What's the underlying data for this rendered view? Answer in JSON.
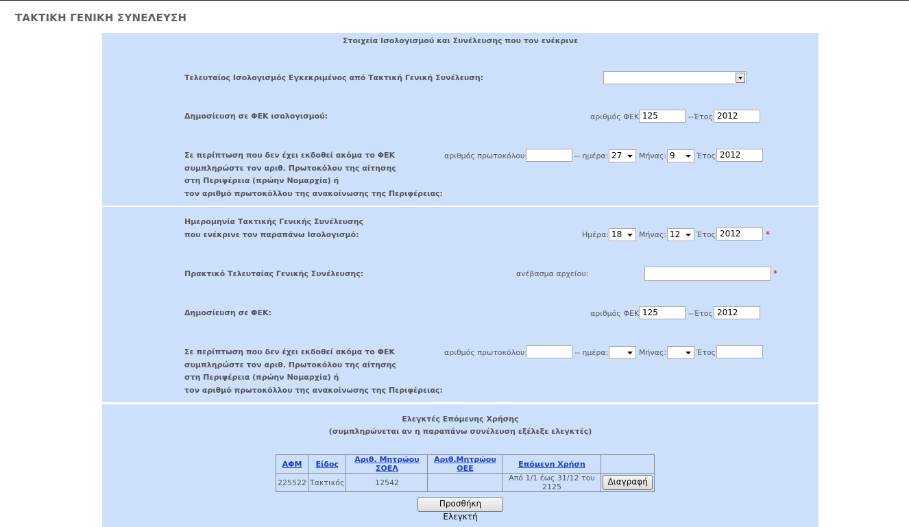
{
  "page_title": "ΤΑΚΤΙΚΗ ΓΕΝΙΚΗ ΣΥΝΕΛΕΥΣΗ",
  "section1": {
    "title": "Στοιχεία Ισολογισμού και Συνέλευσης που τον ενέκρινε",
    "last_balance_label": "Τελευταίος Ισολογισμός Εγκεκριμένος από Τακτική Γενική Συνέλευση:",
    "last_balance_value": "",
    "fek_label": "Δημοσίευση σε ΦΕΚ ισολογισμού:",
    "fek_num_label": "αριθμός ΦΕΚ:",
    "fek_num_value": "125",
    "year_label": "--Έτος:",
    "year_value": "2012",
    "note_lines": [
      "Σε περίπτωση που δεν έχει εκδοθεί ακόμα το ΦΕΚ",
      "συμπληρώστε τον αριθ. Πρωτοκόλου της αίτησης",
      "στη Περιφέρεια (πρώην Νομαρχία) ή",
      "τον αριθμό πρωτοκόλλου της ανακοίνωσης της Περιφέρειας:"
    ],
    "protocol_label": "αριθμός πρωτοκόλου:",
    "protocol_value": "",
    "day_label": "-- ημέρα:",
    "day_value": "27",
    "month_label": "Μήνας:",
    "month_value": "9",
    "year2_label": "Έτος:",
    "year2_value": "2012"
  },
  "section2": {
    "date_label_lines": [
      "Ημερομηνία Τακτικής Γενικής Συνέλευσης",
      "που ενέκρινε τον παραπάνω Ισολογισμό:"
    ],
    "day_label": "Ημέρα:",
    "day_value": "18",
    "month_label": "Μήνας:",
    "month_value": "12",
    "year_label": "Έτος:",
    "year_value": "2012",
    "required_mark": "*",
    "minutes_label": "Πρακτικό Τελευταίας Γενικής Συνέλευσης:",
    "upload_label": "ανέβασμα αρχείου:",
    "upload_value": "",
    "fek_label": "Δημοσίευση σε ΦΕΚ:",
    "fek_num_label": "αριθμός ΦΕΚ:",
    "fek_num_value": "125",
    "fek_year_label": "--Έτος:",
    "fek_year_value": "2012",
    "note_lines": [
      "Σε περίπτωση που δεν έχει εκδοθεί ακόμα το ΦΕΚ",
      "συμπληρώστε τον αριθ. Πρωτοκόλου της αίτησης",
      "στη Περιφέρεια (πρώην Νομαρχία) ή",
      "τον αριθμό πρωτοκόλλου της ανακοίνωσης της Περιφέρειας:"
    ],
    "protocol_label": "αριθμός πρωτοκόλου:",
    "protocol_value": "",
    "day2_label": "-- ημέρα:",
    "day2_value": "",
    "month2_label": "Μήνας:",
    "month2_value": "",
    "year2_label": "Έτος:",
    "year2_value": ""
  },
  "section3": {
    "title": "Ελεγκτές Επόμενης Χρήσης",
    "subtitle": "(συμπληρώνεται αν η παραπάνω συνέλευση εξέλεξε ελεγκτές)",
    "columns": [
      "ΑΦΜ",
      "Είδος",
      "Αριθ. Μητρώου ΣΟΕΛ",
      "Αριθ.Μητρώου ΟΕΕ",
      "Επόμενη Χρήση"
    ],
    "rows": [
      {
        "afm": "225522",
        "type": "Τακτικός",
        "soel": "12542",
        "oee": "",
        "next_use": "Από 1/1 έως 31/12 του 2125",
        "delete_label": "Διαγραφή"
      }
    ],
    "add_button": "Προσθήκη Ελεγκτή"
  }
}
